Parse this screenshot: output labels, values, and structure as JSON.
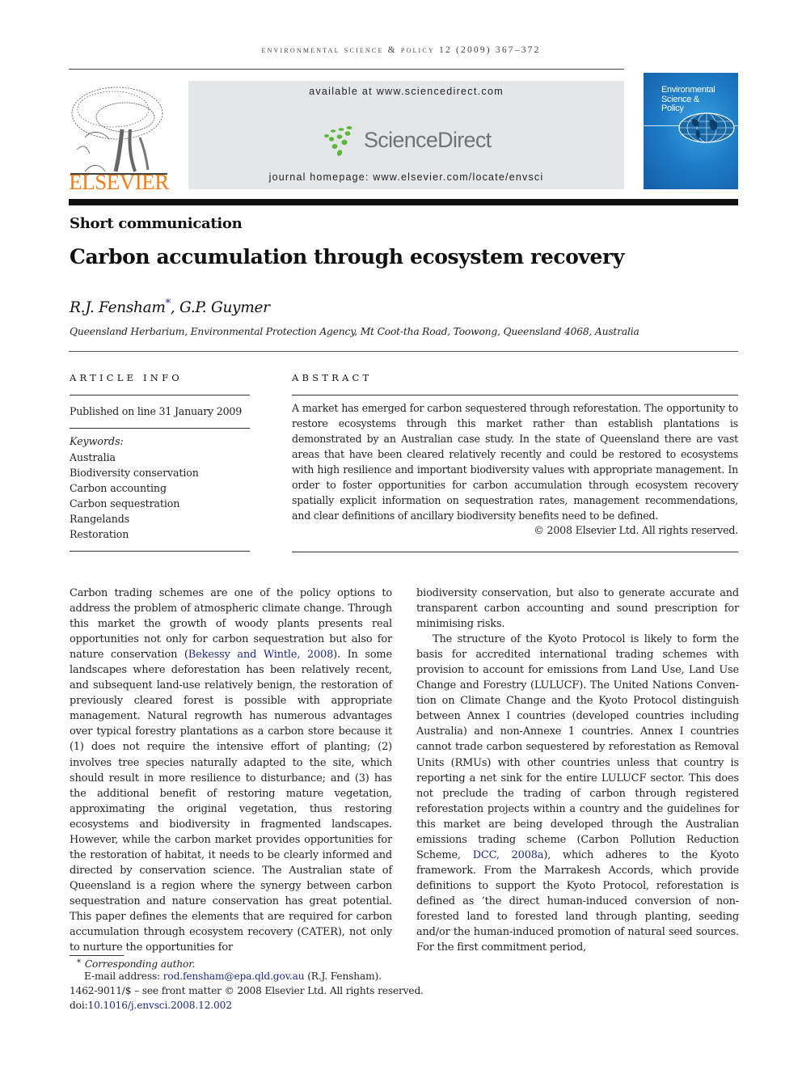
{
  "journal_header": {
    "running_head": "ENVIRONMENTAL SCIENCE & POLICY 12 (2009) 367–372",
    "publisher_logo_text": "ELSEVIER",
    "available_at": "available at www.sciencedirect.com",
    "sciencedirect_logo_text": "ScienceDirect",
    "journal_homepage": "journal homepage: www.elsevier.com/locate/envsci",
    "cover_title_lines": [
      "Environmental",
      "Science &",
      "Policy"
    ]
  },
  "colors": {
    "elsevier_orange": "#f07f1a",
    "sciencedirect_green": "#5cb83a",
    "link_blue": "#1c2a8a",
    "cover_blue": "#1f7dc7",
    "header_gray_box": "#e5e6e8"
  },
  "article": {
    "section_type": "Short communication",
    "title": "Carbon accumulation through ecosystem recovery",
    "authors": [
      {
        "name": "R.J. Fensham",
        "marker": "*"
      },
      {
        "name": "G.P. Guymer",
        "marker": ""
      }
    ],
    "author_separator": ", ",
    "affiliation": "Queensland Herbarium, Environmental Protection Agency, Mt Coot-tha Road, Toowong, Queensland 4068, Australia"
  },
  "article_info": {
    "heading": "ARTICLE INFO",
    "published": "Published on line 31 January 2009",
    "keywords_label": "Keywords:",
    "keywords": [
      "Australia",
      "Biodiversity conservation",
      "Carbon accounting",
      "Carbon sequestration",
      "Rangelands",
      "Restoration"
    ]
  },
  "abstract": {
    "heading": "ABSTRACT",
    "text": "A market has emerged for carbon sequestered through reforestation. The opportunity to restore ecosystems through this market rather than establish plantations is demonstrated by an Australian case study. In the state of Queensland there are vast areas that have been cleared relatively recently and could be restored to ecosystems with high resilience and important biodiversity values with appropriate management. In order to foster opportunities for carbon accumulation through ecosystem recovery spatially explicit information on sequestration rates, management recommendations, and clear definitions of ancillary biodiversity benefits need to be defined.",
    "copyright": "© 2008 Elsevier Ltd. All rights reserved."
  },
  "body": {
    "col1": {
      "p1_before": "Carbon trading schemes are one of the policy options to address the problem of atmospheric climate change. Through this market the growth of woody plants presents real opportunities not only for carbon sequestration but also for nature conservation (",
      "p1_cite": "Bekessy and Wintle, 2008",
      "p1_after": "). In some landscapes where deforestation has been relatively recent, and subsequent land-use relatively benign, the restoration of previously cleared forest is possible with appropriate manage­ment. Natural regrowth has numerous advantages over typical forestry plantations as a carbon store because it (1) does not require the intensive effort of planting; (2) involves tree species naturally adapted to the site, which should result in more resilience to disturbance; and (3) has the additional benefit of restoring mature vegetation, approximating the original vegetation, thus restoring ecosystems and biodiver­sity in fragmented landscapes. However, while the carbon market provides opportunities for the restoration of habitat, it needs to be clearly informed and directed by conservation science. The Australian state of Queensland is a region where the synergy between carbon sequestration and nature con­servation has great potential. This paper defines the elements that are required for carbon accumulation through ecosystem recovery (CATER), not only to nurture the opportunities for"
    },
    "col2": {
      "p1": "biodiversity conservation, but also to generate accurate and transparent carbon accounting and sound prescription for minimising risks.",
      "p2_before": "The structure of the Kyoto Protocol is likely to form the basis for accredited international trading schemes with provision to account for emissions from Land Use, Land Use Change and Forestry (LULUCF). The United Nations Conven­tion on Climate Change and the Kyoto Protocol distinguish between Annex I countries (developed countries including Australia) and non-Annexe 1 countries. Annex I countries cannot trade carbon sequestered by reforestation as Removal Units (RMUs) with other countries unless that country is reporting a net sink for the entire LULUCF sector. This does not preclude the trading of carbon through registered reforesta­tion projects within a country and the guidelines for this market are being developed through the Australian emissions trading scheme (Carbon Pollution Reduction Scheme, ",
      "p2_cite": "DCC, 2008a",
      "p2_after": "), which adheres to the Kyoto framework. From the Marrakesh Accords, which provide definitions to support the Kyoto Protocol, reforestation is defined as ‘the direct human-induced conversion of non-forested land to forested land through planting, seeding and/or the human-induced promo­tion of natural seed sources. For the first commitment period,"
    }
  },
  "footnotes": {
    "marker": "*",
    "corresponding": "Corresponding author.",
    "email_label": "E-mail address: ",
    "email": "rod.fensham@epa.qld.gov.au",
    "email_owner": " (R.J. Fensham).",
    "issn_line": "1462-9011/$ – see front matter © 2008 Elsevier Ltd. All rights reserved.",
    "doi_label": "doi:",
    "doi": "10.1016/j.envsci.2008.12.002"
  }
}
